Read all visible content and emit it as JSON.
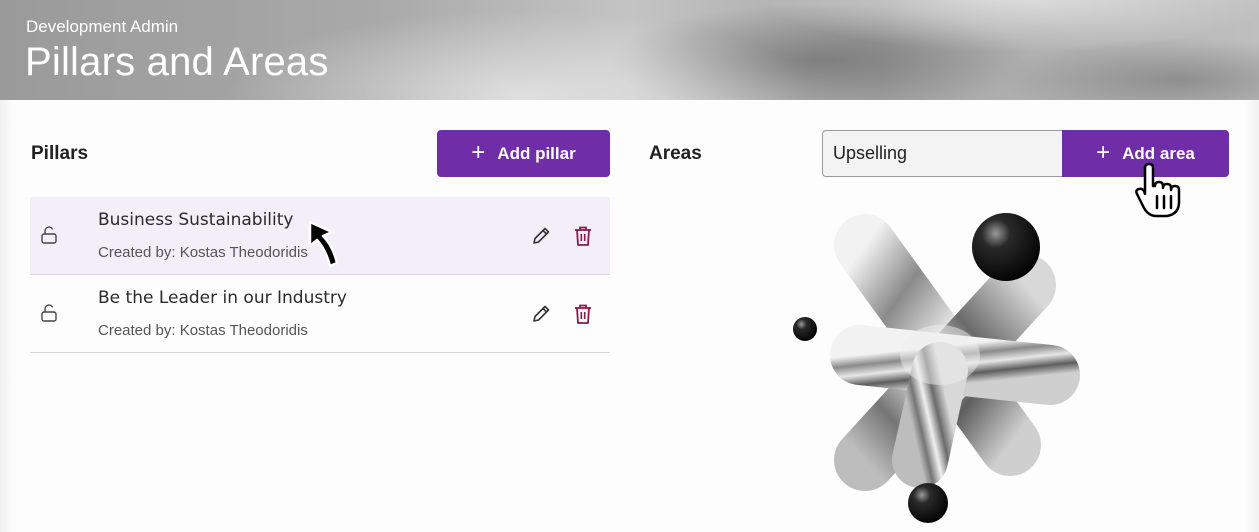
{
  "header": {
    "subtitle": "Development Admin",
    "title": "Pillars and Areas"
  },
  "pillars": {
    "heading": "Pillars",
    "add_button_label": "Add pillar",
    "items": [
      {
        "name": "Business Sustainability",
        "created_by": "Created by: Kostas Theodoridis",
        "selected": true
      },
      {
        "name": "Be the Leader in our Industry",
        "created_by": "Created by: Kostas Theodoridis",
        "selected": false
      }
    ]
  },
  "areas": {
    "heading": "Areas",
    "input_value": "Upselling",
    "add_button_label": "Add area"
  },
  "icons": {
    "lock": "unlocked-padlock-icon",
    "edit": "pencil-icon",
    "delete": "trash-icon",
    "add": "plus-icon"
  },
  "colors": {
    "accent": "#6f2da8",
    "delete": "#8b1a4a",
    "selected_row": "#f4eef9"
  }
}
